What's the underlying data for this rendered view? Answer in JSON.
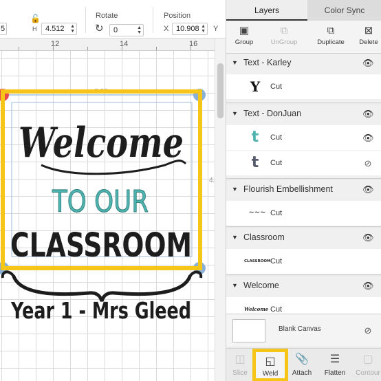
{
  "toolbar": {
    "w_partial": "5",
    "h_label": "H",
    "h_value": "4.512",
    "rotate_label": "Rotate",
    "rotate_value": "0",
    "position_label": "Position",
    "x_label": "X",
    "x_value": "10.908",
    "y_label": "Y"
  },
  "ruler": {
    "ticks": [
      "12",
      "14",
      "16"
    ]
  },
  "design": {
    "size_label": "5.25",
    "side_label": "4.",
    "welcome": "Welcome",
    "to_our": "TO OUR",
    "classroom": "CLASSROOM",
    "year_line": "Year 1 - Mrs Gleed"
  },
  "panel": {
    "tabs": [
      "Layers",
      "Color Sync"
    ],
    "actions": [
      "Group",
      "UnGroup",
      "Duplicate",
      "Delete"
    ],
    "groups": [
      {
        "name": "Text - Karley",
        "rows": [
          {
            "label": "Cut",
            "thumb": "Y",
            "color": "#111111"
          }
        ]
      },
      {
        "name": "Text - DonJuan",
        "rows": [
          {
            "label": "Cut",
            "thumb": "t",
            "color": "#4fb3b0"
          },
          {
            "label": "Cut",
            "thumb": "t",
            "color": "#555b6b"
          }
        ]
      },
      {
        "name": "Flourish Embellishment",
        "rows": [
          {
            "label": "Cut",
            "thumb": "~~~",
            "color": "#444444"
          }
        ]
      },
      {
        "name": "Classroom",
        "rows": [
          {
            "label": "Cut",
            "thumb": "CLASSROOM",
            "color": "#222222"
          }
        ]
      },
      {
        "name": "Welcome",
        "rows": [
          {
            "label": "Cut",
            "thumb": "Welcome",
            "color": "#222222"
          }
        ]
      }
    ],
    "blank_canvas": "Blank Canvas",
    "bottom_actions": [
      "Slice",
      "Weld",
      "Attach",
      "Flatten",
      "Contour"
    ]
  },
  "colors": {
    "highlight": "#f5c518",
    "teal": "#4fb3b0",
    "selection": "#8bb0d8"
  }
}
